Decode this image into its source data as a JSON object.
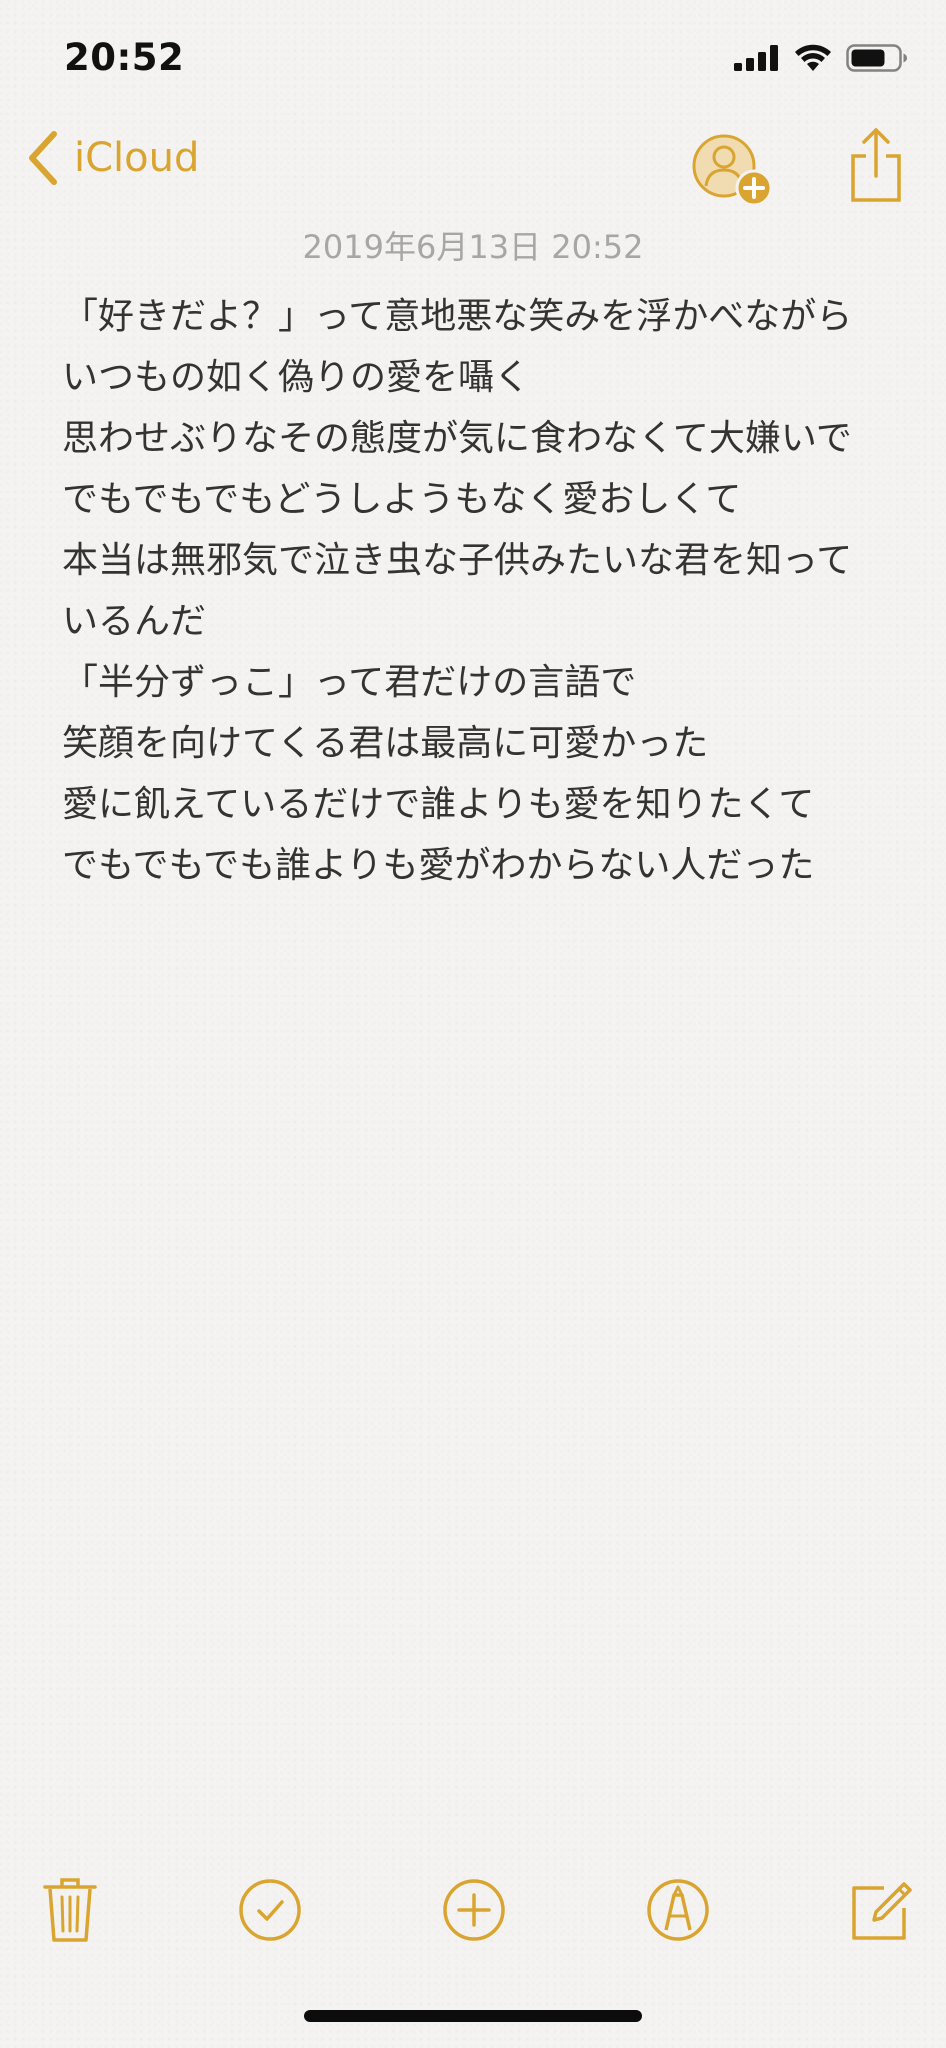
{
  "status_bar": {
    "time": "20:52"
  },
  "nav": {
    "back_label": "iCloud"
  },
  "note": {
    "date": "2019年6月13日 20:52",
    "body": "「好きだよ？」って意地悪な笑みを浮かべながら\nいつもの如く偽りの愛を囁く\n思わせぶりなその態度が気に食わなくて大嫌いで\nでもでもでもどうしようもなく愛おしくて\n本当は無邪気で泣き虫な子供みたいな君を知っているんだ\n「半分ずっこ」って君だけの言語で\n笑顔を向けてくる君は最高に可愛かった\n愛に飢えているだけで誰よりも愛を知りたくて\nでもでもでも誰よりも愛がわからない人だった"
  },
  "colors": {
    "accent": "#d9a530",
    "text": "#333333",
    "date": "#a7a6a4"
  },
  "icons": {
    "back": "chevron-left-icon",
    "add_person": "add-person-icon",
    "share": "share-icon",
    "trash": "trash-icon",
    "checklist": "checkmark-circle-icon",
    "add": "plus-circle-icon",
    "markup": "markup-pen-icon",
    "compose": "compose-icon"
  }
}
